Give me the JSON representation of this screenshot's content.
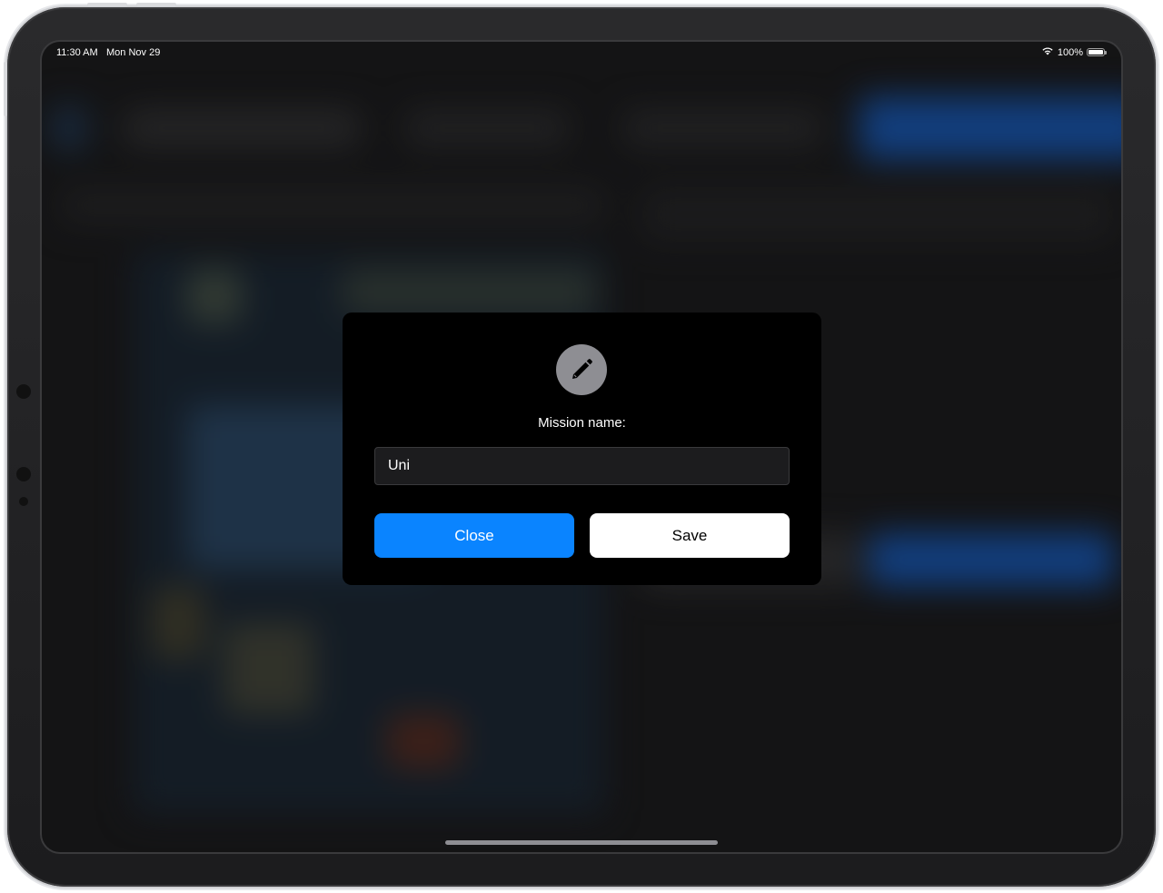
{
  "status_bar": {
    "time": "11:30 AM",
    "date": "Mon Nov 29",
    "battery": "100%",
    "battery_level": 1.0
  },
  "dialog": {
    "icon": "pencil-icon",
    "label": "Mission name:",
    "input_value": "Uni",
    "close_label": "Close",
    "save_label": "Save"
  },
  "colors": {
    "accent": "#0a84ff",
    "dialog_bg": "#000000",
    "icon_circle": "#8e8e93"
  }
}
